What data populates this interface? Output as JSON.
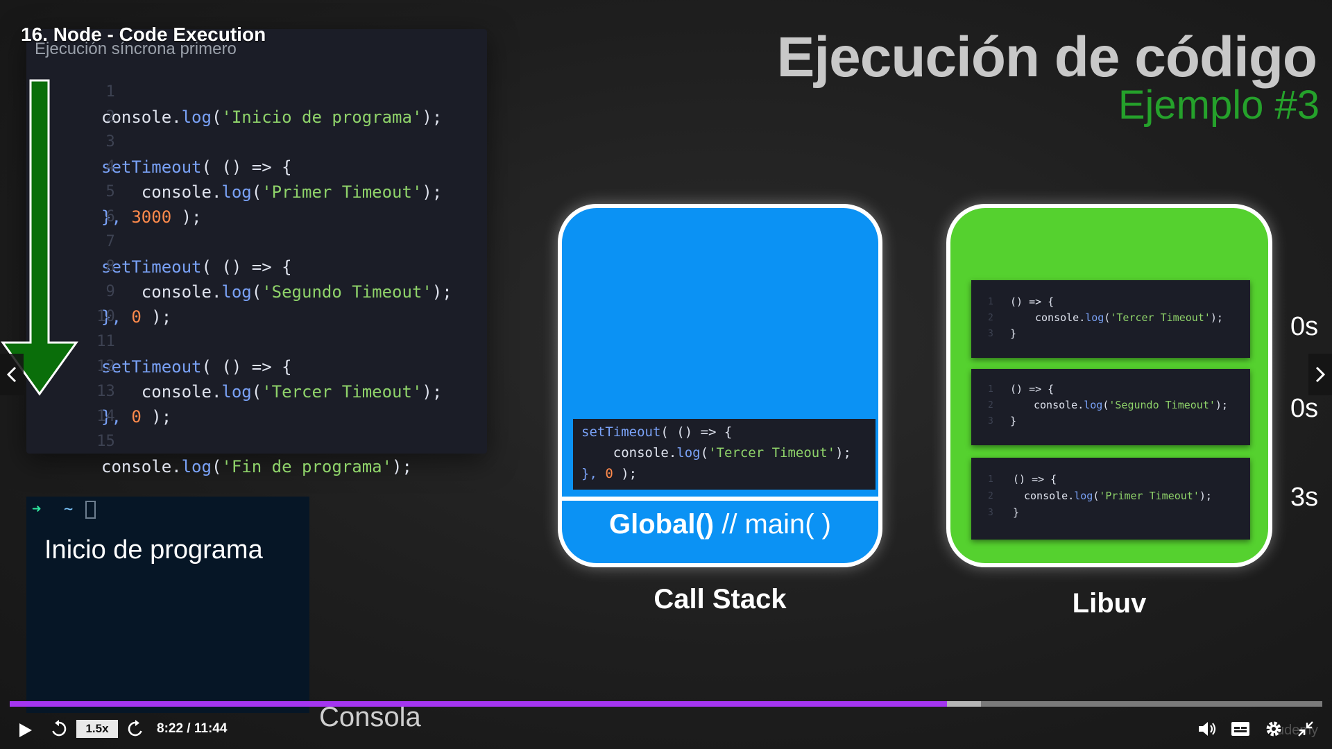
{
  "video": {
    "title": "16. Node - Code Execution",
    "time": "8:22 / 11:44",
    "speed": "1.5x",
    "progress": 0.714,
    "buffered": 0.74,
    "watermark": "udemy"
  },
  "slide": {
    "title": "Ejecución de código",
    "subtitle": "Ejemplo #3",
    "code_subtitle": "Ejecución síncrona primero"
  },
  "code": {
    "line_numbers": [
      "1",
      "2",
      "3",
      "4",
      "5",
      "6",
      "7",
      "8",
      "9",
      "10",
      "11",
      "12",
      "13",
      "14",
      "15"
    ],
    "l1": {
      "fn": "console.",
      "call": "log",
      "open": "(",
      "str": "'Inicio de programa'",
      "close": ");"
    },
    "l3": {
      "fn": "setTimeout",
      "rest": "( () => {"
    },
    "l4": {
      "fn": "    console.",
      "call": "log",
      "open": "(",
      "str": "'Primer Timeout'",
      "close": ");"
    },
    "l5": {
      "pre": "}, ",
      "num": "3000",
      "post": " );"
    },
    "l7": {
      "fn": "setTimeout",
      "rest": "( () => {"
    },
    "l8": {
      "fn": "    console.",
      "call": "log",
      "open": "(",
      "str": "'Segundo Timeout'",
      "close": ");"
    },
    "l9": {
      "pre": "}, ",
      "num": "0",
      "post": " );"
    },
    "l11": {
      "fn": "setTimeout",
      "rest": "( () => {"
    },
    "l12": {
      "fn": "    console.",
      "call": "log",
      "open": "(",
      "str": "'Tercer Timeout'",
      "close": ");"
    },
    "l13": {
      "pre": "}, ",
      "num": "0",
      "post": " );"
    },
    "l15": {
      "fn": "console.",
      "call": "log",
      "open": "(",
      "str": "'Fin de programa'",
      "close": ");"
    }
  },
  "console": {
    "prompt": "➜",
    "dir": "~",
    "output": "Inicio de programa",
    "label": "Consola"
  },
  "call_stack": {
    "label": "Call Stack",
    "global_bold": "Global()",
    "global_rest": " // main( )",
    "frame": {
      "l1_fn": "setTimeout",
      "l1_rest": "( () => {",
      "l2_fn": "    console.",
      "l2_call": "log",
      "l2_open": "(",
      "l2_str": "'Tercer Timeout'",
      "l2_close": ");",
      "l3_pre": "}, ",
      "l3_num": "0",
      "l3_post": " );"
    }
  },
  "libuv": {
    "label": "Libuv",
    "cards": [
      {
        "l1": "() => {",
        "l2_fn": "console.",
        "l2_call": "log",
        "l2_str": "'Tercer Timeout'",
        "l2_close": ");",
        "l3": "}",
        "timer": "0s"
      },
      {
        "l1": "() => {",
        "l2_fn": "console.",
        "l2_call": "log",
        "l2_str": "'Segundo Timeout'",
        "l2_close": ");",
        "l3": "}",
        "timer": "0s"
      },
      {
        "l1": "() => {",
        "l2_fn": "console.",
        "l2_call": "log",
        "l2_str": "'Primer Timeout'",
        "l2_close": ");",
        "l3": "}",
        "timer": "3s"
      }
    ],
    "card_line_numbers": [
      "1",
      "2",
      "3"
    ]
  },
  "colors": {
    "accent": "#a435f0",
    "call_stack": "#0b92f4",
    "libuv": "#55d12f",
    "subtitle_green": "#25a12b",
    "arrow_green": "#0a6e0a"
  }
}
